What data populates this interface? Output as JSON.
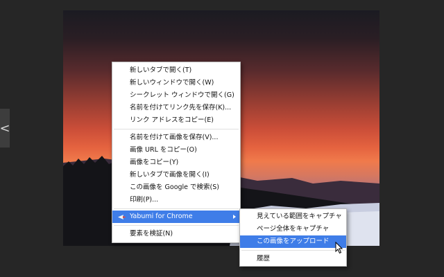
{
  "context_menu": {
    "group_link": [
      "新しいタブで開く(T)",
      "新しいウィンドウで開く(W)",
      "シークレット ウィンドウで開く(G)",
      "名前を付けてリンク先を保存(K)...",
      "リンク アドレスをコピー(E)"
    ],
    "group_image": [
      "名前を付けて画像を保存(V)...",
      "画像 URL をコピー(O)",
      "画像をコピー(Y)",
      "新しいタブで画像を開く(I)",
      "この画像を Google で検索(S)",
      "印刷(P)..."
    ],
    "extension_item": "Yabumi for Chrome",
    "inspect_item": "要素を検証(N)"
  },
  "submenu": {
    "items": [
      "見えている範囲をキャプチャ",
      "ページ全体をキャプチャ",
      "この画像をアップロード"
    ],
    "history": "履歴"
  },
  "side_nav": {
    "prev_glyph": "<"
  },
  "colors": {
    "highlight": "#3f7de8",
    "viewer_bg": "#262626"
  }
}
